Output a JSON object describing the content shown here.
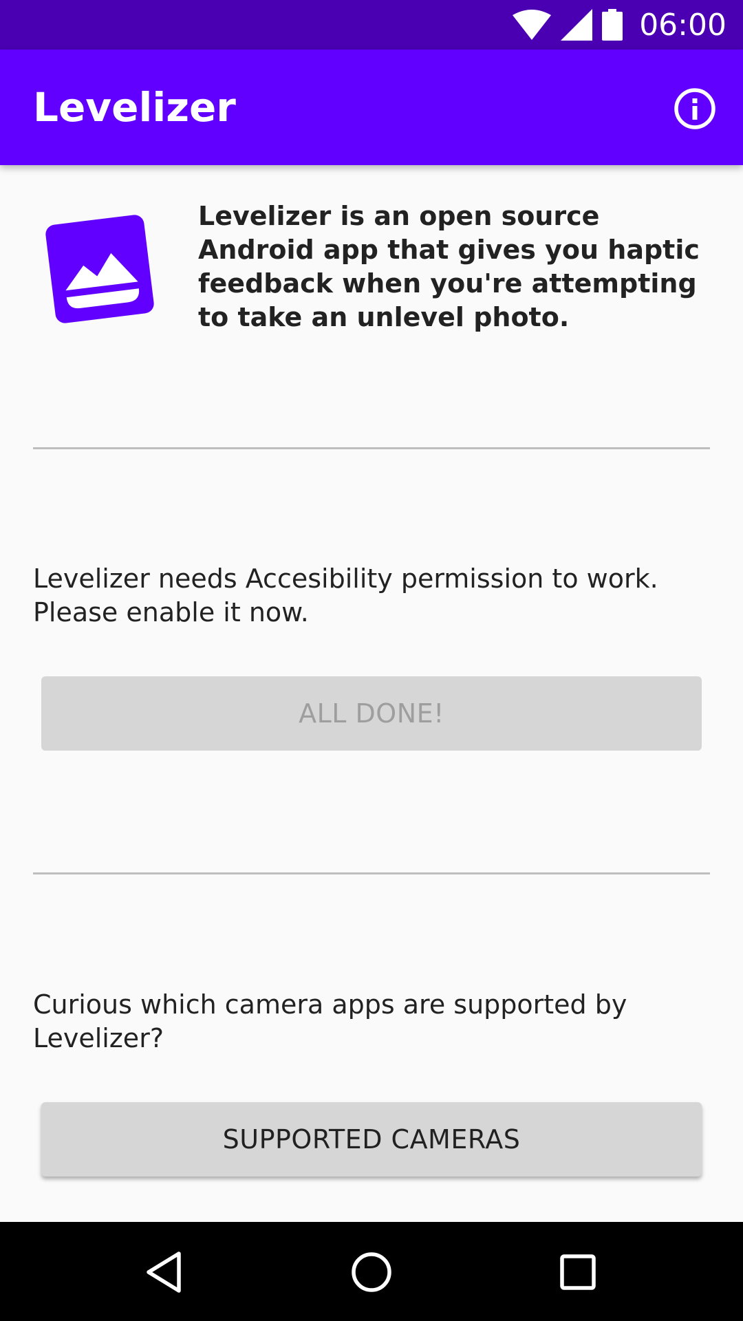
{
  "status_bar": {
    "time": "06:00",
    "icons": [
      "wifi-icon",
      "cellular-signal-icon",
      "battery-icon"
    ]
  },
  "app_bar": {
    "title": "Levelizer",
    "action_icon": "info-icon"
  },
  "intro": {
    "icon": "image-landscape-icon",
    "description": "Levelizer is an open source Android app that gives you haptic feedback when you're attempting to take an unlevel photo."
  },
  "permission": {
    "message": "Levelizer needs Accesibility permission to work. Please enable it now.",
    "button_label": "ALL DONE!",
    "button_enabled": false
  },
  "cameras": {
    "message": "Curious which camera apps are supported by Levelizer?",
    "button_label": "SUPPORTED CAMERAS"
  },
  "nav_bar": {
    "icons": [
      "back-icon",
      "home-icon",
      "recents-icon"
    ]
  },
  "colors": {
    "primary": "#6200ff",
    "primary_dark": "#4a00b2",
    "background": "#fafafa",
    "button": "#d6d6d6"
  }
}
